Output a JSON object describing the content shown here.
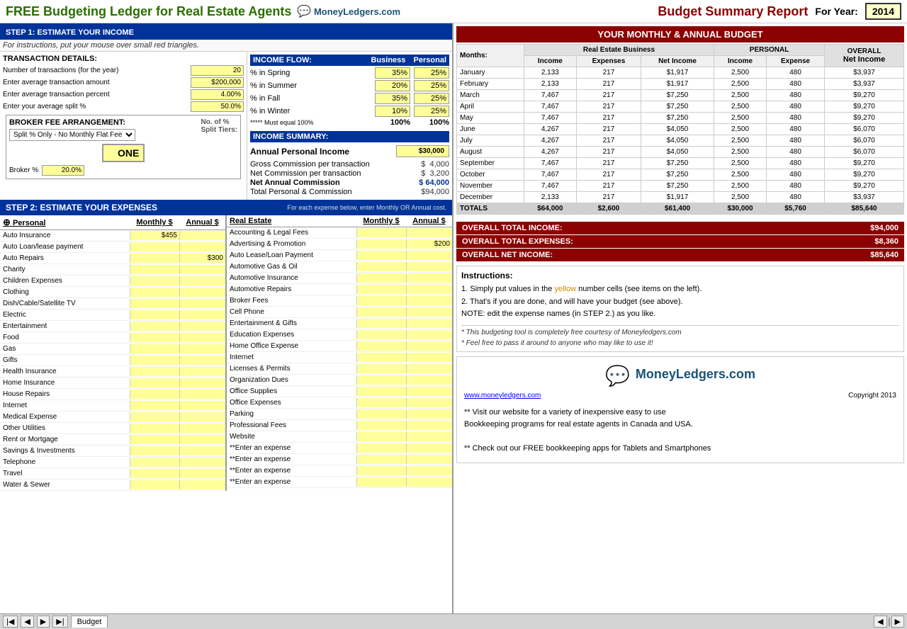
{
  "header": {
    "title": "FREE Budgeting Ledger for Real Estate Agents",
    "logo": "MoneyLedgers.com",
    "budget_summary": "Budget Summary Report",
    "for_year_label": "For Year:",
    "year": "2014"
  },
  "step1": {
    "label": "STEP 1:  ESTIMATE YOUR INCOME",
    "instruction": "For instructions, put your mouse over small red triangles.",
    "transaction_details_label": "TRANSACTION DETAILS:",
    "fields": [
      {
        "label": "Number of transactions (for the year)",
        "value": "20"
      },
      {
        "label": "Enter average transaction amount",
        "value": "$200,000"
      },
      {
        "label": "Enter average transaction percent",
        "value": "4.00%"
      },
      {
        "label": "Enter your average split %",
        "value": "50.0%"
      }
    ],
    "income_flow_label": "INCOME FLOW:",
    "business_col": "Business",
    "personal_col": "Personal",
    "seasons": [
      {
        "label": "% in Spring",
        "business": "35%",
        "personal": "25%"
      },
      {
        "label": "% in Summer",
        "business": "20%",
        "personal": "25%"
      },
      {
        "label": "% in Fall",
        "business": "35%",
        "personal": "25%"
      },
      {
        "label": "% in Winter",
        "business": "10%",
        "personal": "25%"
      },
      {
        "label": "***** Must equal 100%",
        "business": "100%",
        "personal": "100%"
      }
    ],
    "broker_fee_label": "BROKER FEE ARRANGEMENT:",
    "no_of_pct": "No. of %",
    "split_tiers_label": "Split Tiers:",
    "broker_arrangement_options": [
      "Split % Only - No Monthly Flat Fee"
    ],
    "selected_arrangement": "Split Only No Monthly Flat",
    "one_label": "ONE",
    "broker_pct_label": "Broker %",
    "broker_pct_value": "20.0%",
    "income_summary_label": "INCOME SUMMARY:",
    "annual_personal_label": "Annual Personal Income",
    "annual_personal_value": "$30,000",
    "summary_rows": [
      {
        "label": "Gross Commission per transaction",
        "prefix": "$",
        "value": "4,000"
      },
      {
        "label": "Net Commission per transaction",
        "prefix": "$",
        "value": "3,200"
      },
      {
        "label": "Net Annual Commission",
        "prefix": "$",
        "value": "64,000",
        "bold": true
      },
      {
        "label": "Total Personal & Commission",
        "value": "$94,000"
      }
    ]
  },
  "step2": {
    "label": "STEP 2: ESTIMATE YOUR EXPENSES",
    "instruction": "For each expense below, enter Monthly OR Annual cost.",
    "personal_col": "Personal",
    "monthly_label": "Monthly $",
    "annual_label": "Annual $",
    "real_estate_col": "Real Estate",
    "personal_expenses": [
      {
        "name": "Auto Insurance",
        "monthly": "$455",
        "annual": ""
      },
      {
        "name": "Auto Loan/lease payment",
        "monthly": "",
        "annual": ""
      },
      {
        "name": "Auto Repairs",
        "monthly": "",
        "annual": "$300"
      },
      {
        "name": "Charity",
        "monthly": "",
        "annual": ""
      },
      {
        "name": "Children Expenses",
        "monthly": "",
        "annual": ""
      },
      {
        "name": "Clothing",
        "monthly": "",
        "annual": ""
      },
      {
        "name": "Dish/Cable/Satellite TV",
        "monthly": "",
        "annual": ""
      },
      {
        "name": "Electric",
        "monthly": "",
        "annual": ""
      },
      {
        "name": "Entertainment",
        "monthly": "",
        "annual": ""
      },
      {
        "name": "Food",
        "monthly": "",
        "annual": ""
      },
      {
        "name": "Gas",
        "monthly": "",
        "annual": ""
      },
      {
        "name": "Gifts",
        "monthly": "",
        "annual": ""
      },
      {
        "name": "Health Insurance",
        "monthly": "",
        "annual": ""
      },
      {
        "name": "Home Insurance",
        "monthly": "",
        "annual": ""
      },
      {
        "name": "House Repairs",
        "monthly": "",
        "annual": ""
      },
      {
        "name": "Internet",
        "monthly": "",
        "annual": ""
      },
      {
        "name": "Medical Expense",
        "monthly": "",
        "annual": ""
      },
      {
        "name": "Other Utilities",
        "monthly": "",
        "annual": ""
      },
      {
        "name": "Rent or Mortgage",
        "monthly": "",
        "annual": ""
      },
      {
        "name": "Savings & Investments",
        "monthly": "",
        "annual": ""
      },
      {
        "name": "Telephone",
        "monthly": "",
        "annual": ""
      },
      {
        "name": "Travel",
        "monthly": "",
        "annual": ""
      },
      {
        "name": "Water & Sewer",
        "monthly": "",
        "annual": ""
      }
    ],
    "real_estate_expenses": [
      {
        "name": "Accounting & Legal Fees",
        "monthly": "",
        "annual": ""
      },
      {
        "name": "Advertising & Promotion",
        "monthly": "",
        "annual": "$200"
      },
      {
        "name": "Auto Lease/Loan Payment",
        "monthly": "",
        "annual": ""
      },
      {
        "name": "Automotive Gas & Oil",
        "monthly": "",
        "annual": ""
      },
      {
        "name": "Automotive Insurance",
        "monthly": "",
        "annual": ""
      },
      {
        "name": "Automotive Repairs",
        "monthly": "",
        "annual": ""
      },
      {
        "name": "Broker Fees",
        "monthly": "",
        "annual": ""
      },
      {
        "name": "Cell Phone",
        "monthly": "",
        "annual": ""
      },
      {
        "name": "Entertainment & Gifts",
        "monthly": "",
        "annual": ""
      },
      {
        "name": "Education Expenses",
        "monthly": "",
        "annual": ""
      },
      {
        "name": "Home Office Expense",
        "monthly": "",
        "annual": ""
      },
      {
        "name": "Internet",
        "monthly": "",
        "annual": ""
      },
      {
        "name": "Licenses & Permits",
        "monthly": "",
        "annual": ""
      },
      {
        "name": "Organization Dues",
        "monthly": "",
        "annual": ""
      },
      {
        "name": "Office Supplies",
        "monthly": "",
        "annual": ""
      },
      {
        "name": "Office Expenses",
        "monthly": "",
        "annual": ""
      },
      {
        "name": "Parking",
        "monthly": "",
        "annual": ""
      },
      {
        "name": "Professional Fees",
        "monthly": "",
        "annual": ""
      },
      {
        "name": "Website",
        "monthly": "",
        "annual": ""
      },
      {
        "name": "**Enter an expense",
        "monthly": "",
        "annual": ""
      },
      {
        "name": "**Enter an expense",
        "monthly": "",
        "annual": ""
      },
      {
        "name": "**Enter an expense",
        "monthly": "",
        "annual": ""
      },
      {
        "name": "**Enter an expense",
        "monthly": "",
        "annual": ""
      }
    ]
  },
  "budget_table": {
    "title": "YOUR MONTHLY & ANNUAL BUDGET",
    "real_estate_label": "Real Estate Business",
    "personal_label": "PERSONAL",
    "overall_label": "OVERALL",
    "months_label": "Months:",
    "income_label": "Income",
    "expenses_label": "Expenses",
    "net_income_label": "Net Income",
    "expense_label": "Expense",
    "rows": [
      {
        "month": "January",
        "re_income": "2,133",
        "re_expenses": "217",
        "re_net": "$1,917",
        "p_income": "2,500",
        "p_expense": "480",
        "overall": "$3,937"
      },
      {
        "month": "February",
        "re_income": "2,133",
        "re_expenses": "217",
        "re_net": "$1,917",
        "p_income": "2,500",
        "p_expense": "480",
        "overall": "$3,937"
      },
      {
        "month": "March",
        "re_income": "7,467",
        "re_expenses": "217",
        "re_net": "$7,250",
        "p_income": "2,500",
        "p_expense": "480",
        "overall": "$9,270"
      },
      {
        "month": "April",
        "re_income": "7,467",
        "re_expenses": "217",
        "re_net": "$7,250",
        "p_income": "2,500",
        "p_expense": "480",
        "overall": "$9,270"
      },
      {
        "month": "May",
        "re_income": "7,467",
        "re_expenses": "217",
        "re_net": "$7,250",
        "p_income": "2,500",
        "p_expense": "480",
        "overall": "$9,270"
      },
      {
        "month": "June",
        "re_income": "4,267",
        "re_expenses": "217",
        "re_net": "$4,050",
        "p_income": "2,500",
        "p_expense": "480",
        "overall": "$6,070"
      },
      {
        "month": "July",
        "re_income": "4,267",
        "re_expenses": "217",
        "re_net": "$4,050",
        "p_income": "2,500",
        "p_expense": "480",
        "overall": "$6,070"
      },
      {
        "month": "August",
        "re_income": "4,267",
        "re_expenses": "217",
        "re_net": "$4,050",
        "p_income": "2,500",
        "p_expense": "480",
        "overall": "$6,070"
      },
      {
        "month": "September",
        "re_income": "7,467",
        "re_expenses": "217",
        "re_net": "$7,250",
        "p_income": "2,500",
        "p_expense": "480",
        "overall": "$9,270"
      },
      {
        "month": "October",
        "re_income": "7,467",
        "re_expenses": "217",
        "re_net": "$7,250",
        "p_income": "2,500",
        "p_expense": "480",
        "overall": "$9,270"
      },
      {
        "month": "November",
        "re_income": "7,467",
        "re_expenses": "217",
        "re_net": "$7,250",
        "p_income": "2,500",
        "p_expense": "480",
        "overall": "$9,270"
      },
      {
        "month": "December",
        "re_income": "2,133",
        "re_expenses": "217",
        "re_net": "$1,917",
        "p_income": "2,500",
        "p_expense": "480",
        "overall": "$3,937"
      }
    ],
    "totals": {
      "label": "TOTALS",
      "re_income": "$64,000",
      "re_expenses": "$2,600",
      "re_net": "$61,400",
      "p_income": "$30,000",
      "p_expense": "$5,760",
      "overall": "$85,640"
    }
  },
  "overall_summary": {
    "total_income_label": "OVERALL TOTAL INCOME:",
    "total_income_value": "$94,000",
    "total_expenses_label": "OVERALL TOTAL EXPENSES:",
    "total_expenses_value": "$8,360",
    "net_income_label": "OVERALL NET INCOME:",
    "net_income_value": "$85,640"
  },
  "instructions": {
    "title": "Instructions:",
    "line1": "1.  Simply put values in the yellow number cells (see items on the left).",
    "line2": "2.  That's if you are done, and will have your budget (see above).",
    "note": "NOTE: edit the expense names (in STEP 2.) as you like.",
    "italic1": "* This budgeting tool is completely free courtesy of Moneyledgers.com",
    "italic2": "* Feel free to pass it around to anyone who may like to use it!"
  },
  "moneyledgers": {
    "logo_text": "MoneyLedgers.com",
    "url": "www.moneyledgers.com",
    "copyright": "Copyright 2013",
    "text1": "** Visit our website for a variety of inexpensive easy to use",
    "text2": "     Bookkeeping programs for real estate agents in Canada and USA.",
    "text3": "** Check out our FREE bookkeeping apps for Tablets and Smartphones"
  },
  "bottom": {
    "sheet_tab": "Budget"
  }
}
